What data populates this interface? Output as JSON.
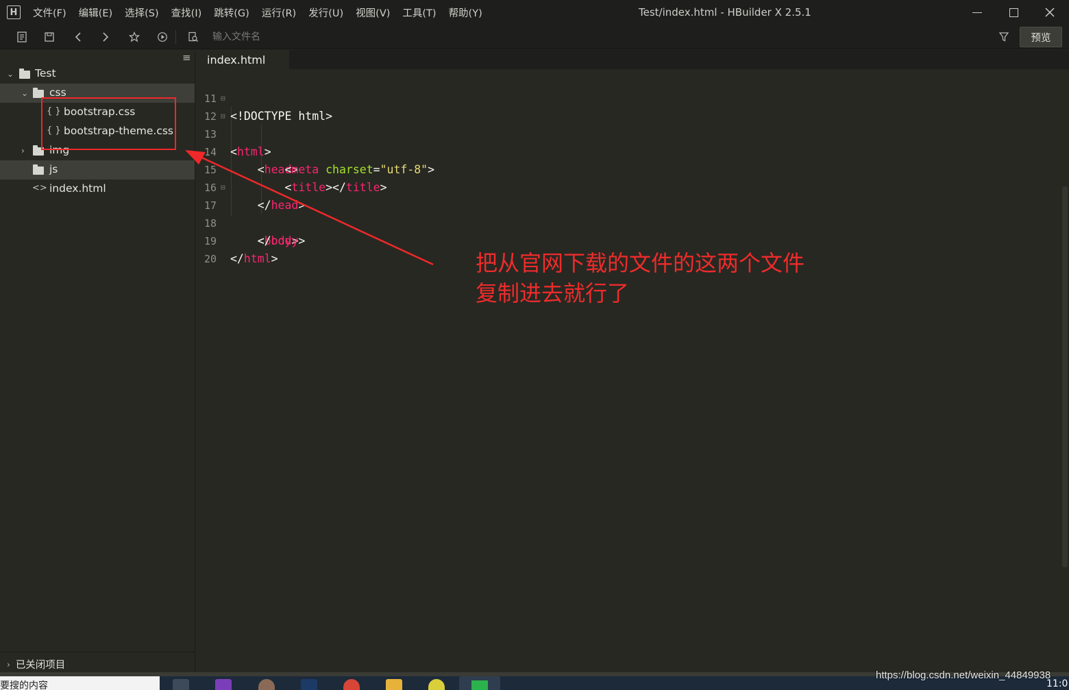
{
  "app": {
    "window_title": "Test/index.html - HBuilder X 2.5.1",
    "logo": "H",
    "menu": [
      "文件(F)",
      "编辑(E)",
      "选择(S)",
      "查找(I)",
      "跳转(G)",
      "运行(R)",
      "发行(U)",
      "视图(V)",
      "工具(T)",
      "帮助(Y)"
    ]
  },
  "toolbar": {
    "search_placeholder": "输入文件名",
    "preview_label": "预览",
    "icons": [
      "new-file-icon",
      "save-icon",
      "back-icon",
      "forward-icon",
      "star-icon",
      "run-icon",
      "file-search-icon",
      "filter-icon"
    ]
  },
  "sidebar": {
    "tree": [
      {
        "label": "Test",
        "type": "project",
        "expanded": true
      },
      {
        "label": "css",
        "type": "folder",
        "expanded": true
      },
      {
        "label": "bootstrap.css",
        "type": "css-file"
      },
      {
        "label": "bootstrap-theme.css",
        "type": "css-file"
      },
      {
        "label": "img",
        "type": "folder",
        "expanded": false
      },
      {
        "label": "js",
        "type": "folder"
      },
      {
        "label": "index.html",
        "type": "html-file"
      }
    ],
    "closed_projects": "已关闭项目"
  },
  "editor": {
    "tab": "index.html",
    "line_numbers": [
      "11",
      "12",
      "13",
      "14",
      "15",
      "16",
      "17",
      "18",
      "19",
      "20"
    ]
  },
  "annotation": {
    "line1": "把从官网下载的文件的这两个文件",
    "line2": "复制进去就行了",
    "color": "#ef2b2b"
  },
  "taskbar": {
    "search_text": "要搜的内容",
    "clock": "11:0"
  },
  "watermark": "https://blog.csdn.net/weixin_44849938",
  "colors": {
    "editor_bg": "#272822",
    "tag": "#f92672",
    "attribute": "#a6e22e",
    "string": "#e6db74"
  }
}
